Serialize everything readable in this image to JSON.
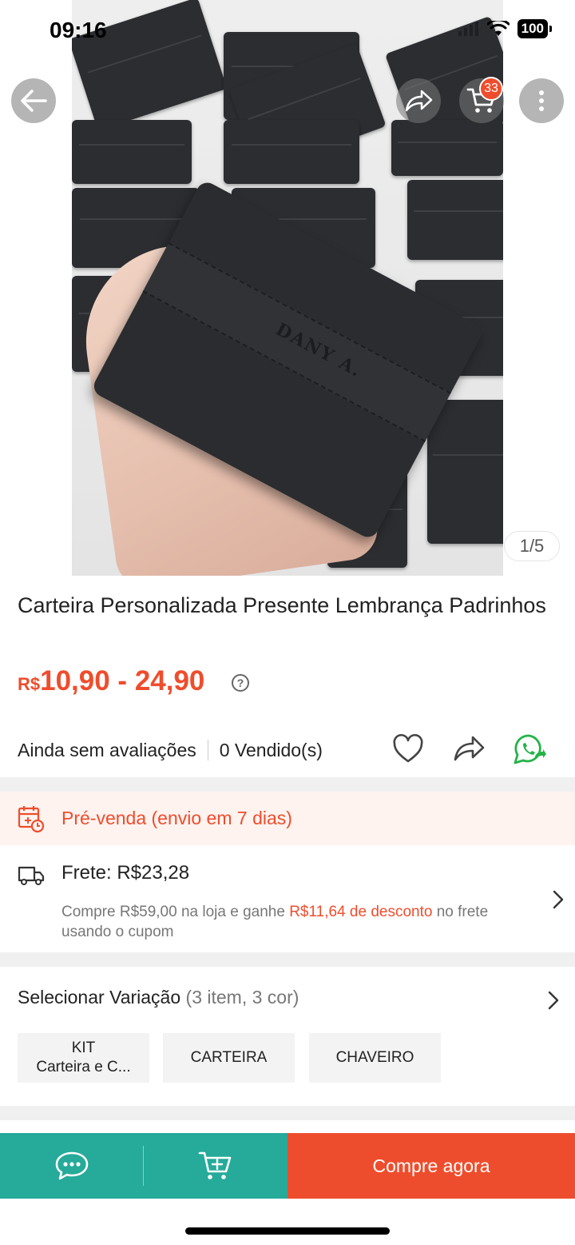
{
  "status_bar": {
    "time": "09:16",
    "battery": "100"
  },
  "gallery": {
    "counter": "1/5",
    "engraving": "DANY A."
  },
  "header": {
    "cart_count": "33"
  },
  "product": {
    "title": "Carteira Personalizada Presente Lembrança Padrinhos",
    "currency": "R$",
    "price_range": "10,90 - 24,90",
    "reviews_text": "Ainda sem avaliações",
    "sold_text": "0 Vendido(s)"
  },
  "preorder": {
    "label": "Pré-venda (envio em 7 dias)"
  },
  "shipping": {
    "title": "Frete: R$23,28",
    "desc_before": "Compre R$59,00 na loja e ganhe ",
    "desc_highlight": "R$11,64 de desconto",
    "desc_after": " no frete usando o cupom"
  },
  "variation": {
    "title": "Selecionar Variação",
    "subtitle": "(3 item, 3 cor)",
    "options": [
      {
        "line1": "KIT",
        "line2": "Carteira e C..."
      },
      {
        "line1": "CARTEIRA"
      },
      {
        "line1": "CHAVEIRO"
      }
    ]
  },
  "bottom_bar": {
    "buy_label": "Compre agora"
  },
  "colors": {
    "accent": "#ee4d2d",
    "teal": "#26aa99",
    "whatsapp": "#25b248"
  }
}
